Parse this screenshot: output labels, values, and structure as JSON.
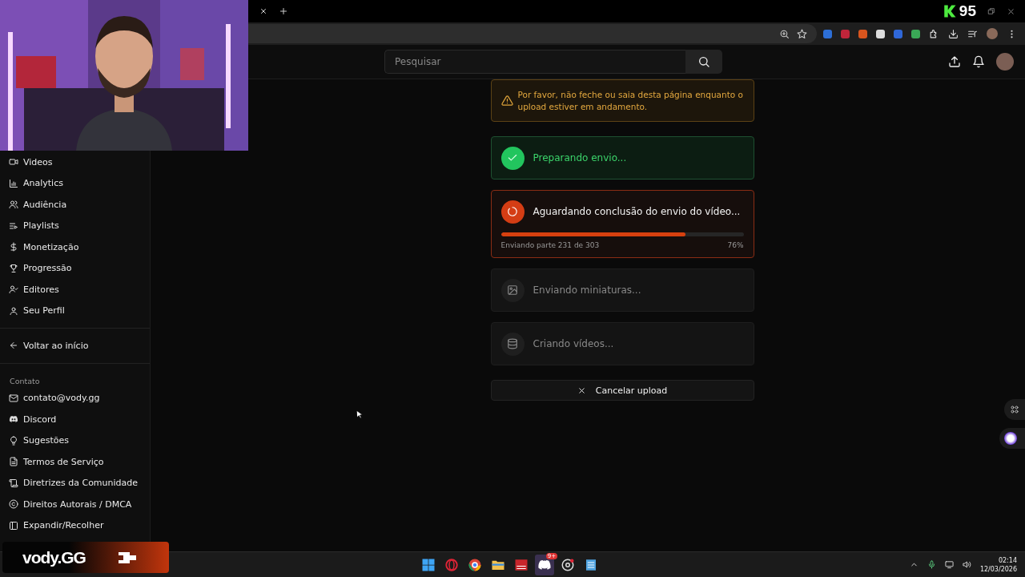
{
  "stream_overlay": {
    "score": "95",
    "brand": "vody.GG"
  },
  "header": {
    "search": {
      "placeholder": "Pesquisar"
    }
  },
  "sidebar": {
    "nav": [
      {
        "label": "Videos"
      },
      {
        "label": "Analytics"
      },
      {
        "label": "Audiência"
      },
      {
        "label": "Playlists"
      },
      {
        "label": "Monetização"
      },
      {
        "label": "Progressão"
      },
      {
        "label": "Editores"
      },
      {
        "label": "Seu Perfil"
      }
    ],
    "back": "Voltar ao início",
    "contact_heading": "Contato",
    "contact": [
      {
        "label": "contato@vody.gg"
      },
      {
        "label": "Discord"
      },
      {
        "label": "Sugestões"
      },
      {
        "label": "Termos de Serviço"
      },
      {
        "label": "Diretrizes da Comunidade"
      },
      {
        "label": "Direitos Autorais / DMCA"
      },
      {
        "label": "Expandir/Recolher"
      }
    ]
  },
  "upload": {
    "warning": "Por favor, não feche ou saia desta página enquanto o upload estiver em andamento.",
    "steps": [
      {
        "kind": "done",
        "label": "Preparando envio..."
      },
      {
        "kind": "active",
        "label": "Aguardando conclusão do envio do vídeo...",
        "level": 0.76,
        "detail": "Enviando parte 231 de 303",
        "percent": "76%"
      },
      {
        "kind": "pending",
        "label": "Enviando miniaturas..."
      },
      {
        "kind": "pending",
        "label": "Criando vídeos..."
      }
    ],
    "cancel": "Cancelar upload"
  },
  "taskbar": {
    "badge": "9+",
    "time": "02:14",
    "date": "12/03/2026"
  }
}
